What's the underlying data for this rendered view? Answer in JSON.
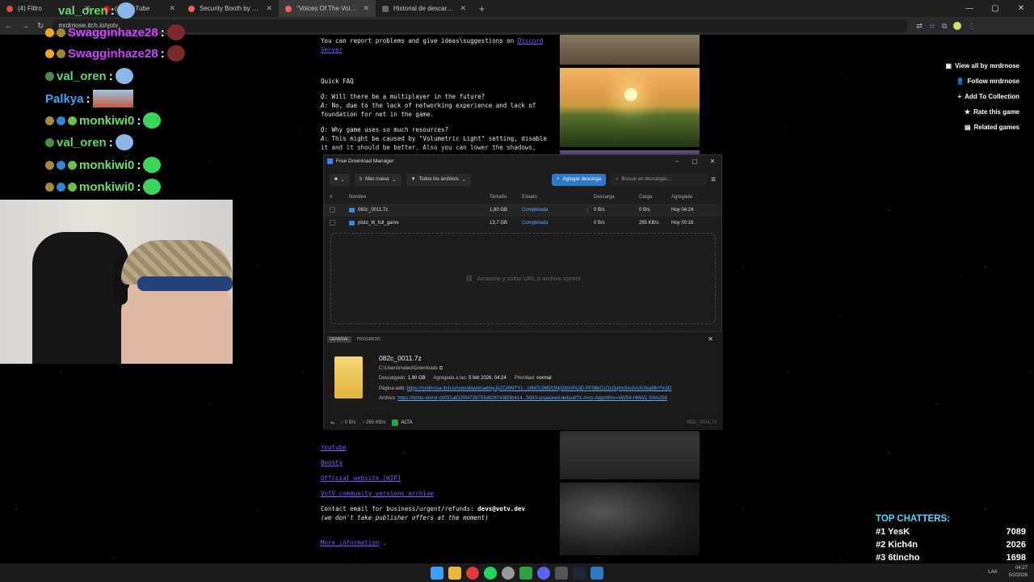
{
  "browser": {
    "tabs": [
      {
        "title": "(4) Filtro",
        "active": false
      },
      {
        "title": "(4) YouTube",
        "active": false
      },
      {
        "title": "Security Booth by Kyle Horwood",
        "active": false
      },
      {
        "title": "\"Voices Of The Void\" Pre-Alpha",
        "active": true
      },
      {
        "title": "Historial de descargas",
        "active": false
      }
    ],
    "url": "mrdrnose.itch.io/votv"
  },
  "page": {
    "report_text": "You can report problems and give ideas\\suggestions on ",
    "discord_link": "Discord Server",
    "faq_heading": "Quick FAQ",
    "faq": [
      {
        "q": "Will there be a multiplayer in the future?",
        "a": "No, due to the lack of networking experience and lack of foundation for net in the game."
      },
      {
        "q": "Why game uses so much resources?",
        "a": "This might be caused by \"Volumetric Light\" setting, disable it and it should be better. Also you can lower the shadows,"
      }
    ],
    "links": [
      "Youtube",
      "Boosty",
      "Official website [WIP]",
      "VotV community versions archive"
    ],
    "contact_label": "Contact email for business/urgent/refunds: ",
    "contact_email": "devs@votv.dev",
    "publisher_note": "(we don't take publisher offers at the moment)",
    "more_info": "More information",
    "side_buttons": [
      "View all by mrdrnose",
      "Follow mrdrnose",
      "Add To Collection",
      "Rate this game",
      "Related games"
    ]
  },
  "chat": [
    {
      "user": "val_oren",
      "color": "#5bd86a",
      "emote_color": "#8ab6e8"
    },
    {
      "user": "Swagginhaze28",
      "color": "#cc44ff",
      "emote_color": "#7a2a2a"
    },
    {
      "user": "Swagginhaze28",
      "color": "#cc44ff",
      "emote_color": "#7a2a2a"
    },
    {
      "user": "val_oren",
      "color": "#5bd86a",
      "emote_color": "#8ab6e8"
    },
    {
      "user": "Palkya",
      "color": "#33aaff",
      "emote_color": "#9ac8e8"
    },
    {
      "user": "monkiwi0",
      "color": "#6ae06a",
      "emote_color": "#3ad65a"
    },
    {
      "user": "val_oren",
      "color": "#5bd86a",
      "emote_color": "#8ab6e8"
    },
    {
      "user": "monkiwi0",
      "color": "#6ae06a",
      "emote_color": "#3ad65a"
    },
    {
      "user": "monkiwi0",
      "color": "#6ae06a",
      "emote_color": "#3ad65a"
    }
  ],
  "fdm": {
    "window_title": "Free Download Manager",
    "toolbar": {
      "sort": "Más nueva",
      "filter": "Todos los archivos",
      "add": "Agregar descarga",
      "search_placeholder": "Buscar en descargas..."
    },
    "columns": [
      "#",
      "Nombre",
      "Tamaño",
      "Estado",
      "Descarga",
      "Carga",
      "Agregada"
    ],
    "rows": [
      {
        "name": "082c_0011.7z",
        "size": "1,90 GB",
        "state": "Completada",
        "down": "0 B/s",
        "up": "0 B/s",
        "added": "Hoy 04:24"
      },
      {
        "name": "pluto_t6_full_game",
        "size": "13,7 GB",
        "state": "Completada",
        "down": "0 B/s",
        "up": "265 KB/s",
        "added": "Hoy 00:16"
      }
    ],
    "dropzone": "Arrastrar y soltar URL o archivo torrent",
    "detail_tabs": [
      "GENERAL",
      "PROGRESO"
    ],
    "detail": {
      "file": "082c_0011.7z",
      "path": "C:\\Users\\mateo\\Downloads",
      "downloaded_label": "Descargado:",
      "downloaded": "1,90 GB",
      "added_label": "Agregada a las:",
      "added": "5 feb 2026, 04:24",
      "priority_label": "Prioridad:",
      "priority": "normal",
      "web_label": "Página web:",
      "web": "https://mrdrnose.itch.io/votv/download/eyJpZCI6MTYz...16MTc3MDI3NjI2NX0%3D.PF08kCcO1GqHu3m2vs3UNa9tkY%3D",
      "archive_label": "Archivo:",
      "archive": "https://itchio-mirror.cb031a832f44726753d6267436f3b414...5063-unpacked-default?X-Amz-Algorithm=AWS4-HMAC-SHA256"
    },
    "status": {
      "down": "↓ 0 B/s",
      "up": "↑ 265 KB/s",
      "priority": "ALTA",
      "file": "082c_0011.7z"
    }
  },
  "chatters": {
    "title": "TOP CHATTERS:",
    "list": [
      {
        "rank": "#1",
        "name": "YesK",
        "count": "7089"
      },
      {
        "rank": "#2",
        "name": "Kich4n",
        "count": "2026"
      },
      {
        "rank": "#3",
        "name": "6tincho",
        "count": "1698"
      }
    ]
  },
  "tray": {
    "lang": "LAA",
    "time": "04:27",
    "date": "5/2/2026"
  }
}
